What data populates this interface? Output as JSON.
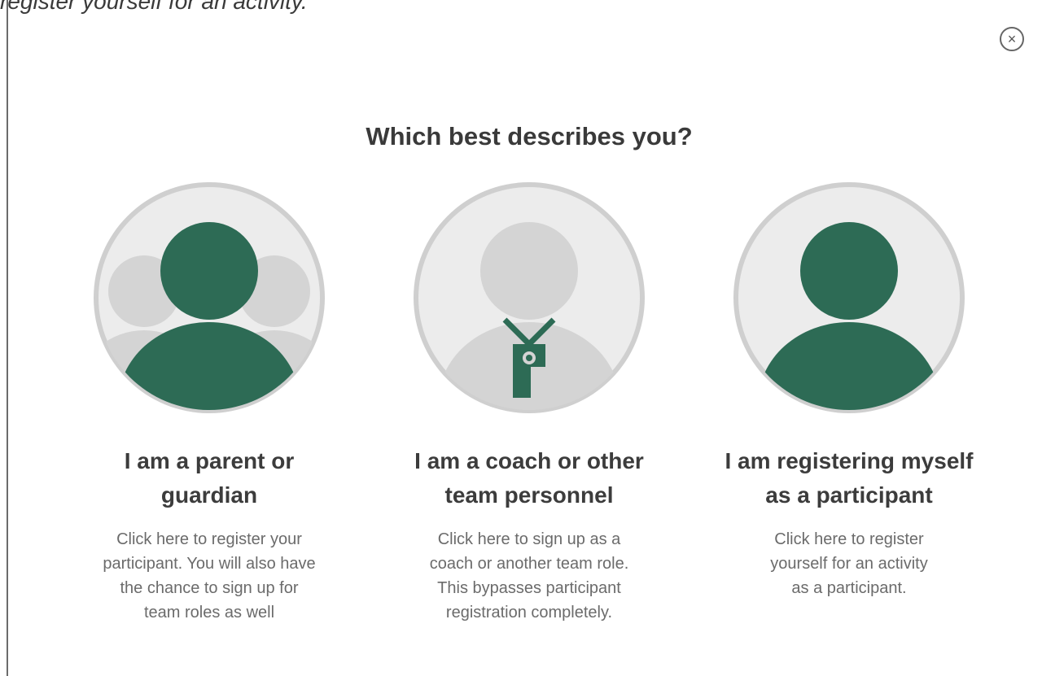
{
  "background": {
    "partial_text": "register yourself for an activity."
  },
  "modal": {
    "title": "Which best describes you?",
    "close_label": "×",
    "options": [
      {
        "title_line1": "I am a parent or",
        "title_line2": "guardian",
        "desc_lines": [
          "Click here to register your",
          "participant. You will also have",
          "the chance to sign up for",
          "team roles as well"
        ]
      },
      {
        "title_line1": "I am a coach or other",
        "title_line2": "team personnel",
        "desc_lines": [
          "Click here to sign up as a",
          "coach or another team role.",
          "This bypasses participant",
          "registration completely."
        ]
      },
      {
        "title_line1": "I am registering myself",
        "title_line2": "as a participant",
        "desc_lines": [
          "Click here to register",
          "yourself for an activity",
          "as a participant."
        ]
      }
    ]
  },
  "colors": {
    "accent_green": "#2d6b55",
    "avatar_bg": "#ececec",
    "avatar_ring": "#cfcfcf",
    "ghost_gray": "#d4d4d4"
  }
}
